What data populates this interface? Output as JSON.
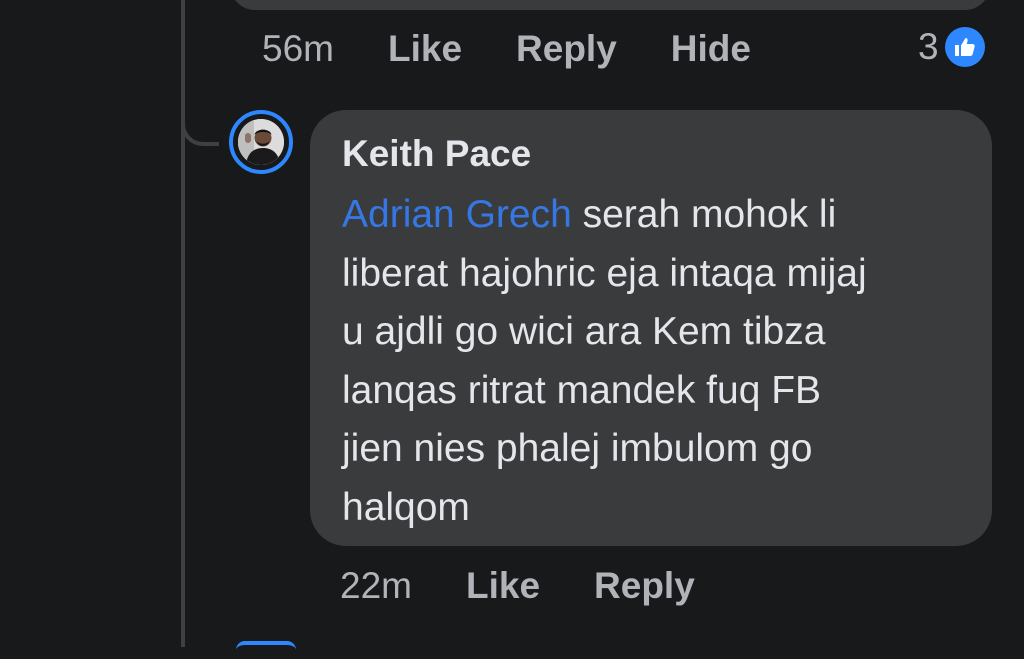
{
  "previous_comment": {
    "time": "56m",
    "actions": [
      "Like",
      "Reply",
      "Hide"
    ],
    "reaction_count": "3",
    "reaction_icon": "like-thumb-icon"
  },
  "reply": {
    "author": "Keith Pace",
    "mention": "Adrian Grech",
    "lines": [
      " serah mohok li",
      "liberat hajohric eja intaqa mijaj",
      "u ajdli go wici ara Kem tibza",
      "lanqas ritrat mandek fuq FB",
      "jien nies phalej imbulom go",
      "halqom"
    ],
    "time": "22m",
    "actions": [
      "Like",
      "Reply"
    ]
  },
  "colors": {
    "background": "#18191a",
    "bubble": "#3a3b3c",
    "mention": "#3578e5",
    "accent": "#2d88ff",
    "secondary_text": "#b0b3b8"
  }
}
